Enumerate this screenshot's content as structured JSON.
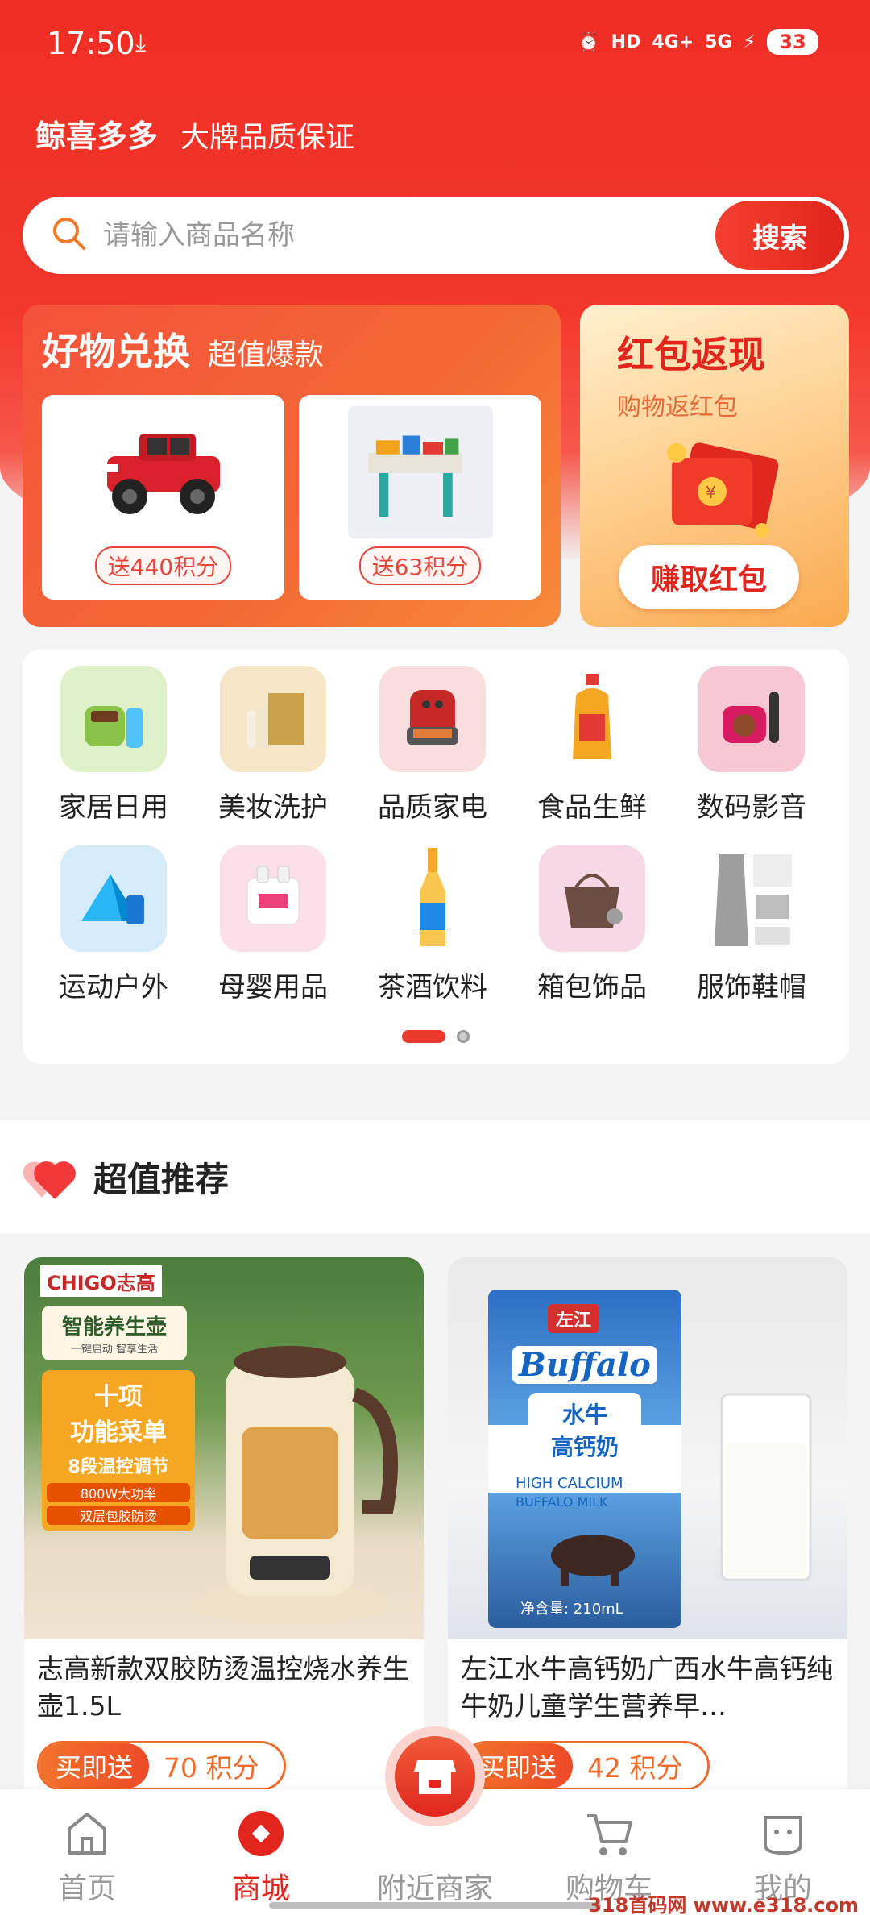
{
  "status": {
    "time": "17:50",
    "battery": "33",
    "network_5g": "5G",
    "network_4g": "4G+",
    "hd": "HD"
  },
  "brand": {
    "name": "鲸喜多多",
    "slogan": "大牌品质保证"
  },
  "search": {
    "placeholder": "请输入商品名称",
    "button": "搜索"
  },
  "promo_exchange": {
    "title": "好物兑换",
    "subtitle": "超值爆款",
    "items": [
      {
        "image": "red toy jeep",
        "tag": "送440积分"
      },
      {
        "image": "building block table",
        "tag": "送63积分"
      }
    ]
  },
  "promo_redpacket": {
    "title": "红包返现",
    "subtitle": "购物返红包",
    "button": "赚取红包"
  },
  "categories": [
    {
      "label": "家居日用",
      "icon": "home-goods-icon"
    },
    {
      "label": "美妆洗护",
      "icon": "cosmetics-icon"
    },
    {
      "label": "品质家电",
      "icon": "appliance-icon"
    },
    {
      "label": "食品生鲜",
      "icon": "food-icon"
    },
    {
      "label": "数码影音",
      "icon": "digital-icon"
    },
    {
      "label": "运动户外",
      "icon": "outdoor-icon"
    },
    {
      "label": "母婴用品",
      "icon": "baby-icon"
    },
    {
      "label": "茶酒饮料",
      "icon": "drinks-icon"
    },
    {
      "label": "箱包饰品",
      "icon": "bags-icon"
    },
    {
      "label": "服饰鞋帽",
      "icon": "apparel-icon"
    }
  ],
  "recommend": {
    "title": "超值推荐",
    "products": [
      {
        "name": "志高新款双胶防烫温控烧水养生壶1.5L",
        "tag_a": "买即送",
        "tag_b": "70 积分",
        "image_text": {
          "brand": "CHIGO志高",
          "line1": "智能养生壶",
          "line2": "一键启动 智享生活",
          "line3": "十项",
          "line4": "功能菜单",
          "line5": "8段温控调节",
          "line6": "800W大功率",
          "line7": "双层包胶防烫"
        }
      },
      {
        "name": "左江水牛高钙奶广西水牛高钙纯牛奶儿童学生营养早…",
        "tag_a": "买即送",
        "tag_b": "42 积分",
        "image_text": {
          "brand": "左江",
          "logo": "Buffalo",
          "line1": "水牛",
          "line2": "高钙奶",
          "line3": "HIGH CALCIUM",
          "line4": "BUFFALO MILK",
          "volume": "净含量: 210mL"
        }
      }
    ]
  },
  "nav": [
    {
      "label": "首页",
      "active": false
    },
    {
      "label": "商城",
      "active": true
    },
    {
      "label": "附近商家",
      "active": false
    },
    {
      "label": "购物车",
      "active": false
    },
    {
      "label": "我的",
      "active": false
    }
  ],
  "watermark": "318首码网 www.e318.com",
  "colors": {
    "primary": "#e2261d",
    "accent_orange": "#f06a2a",
    "background": "#f4f4f4"
  }
}
